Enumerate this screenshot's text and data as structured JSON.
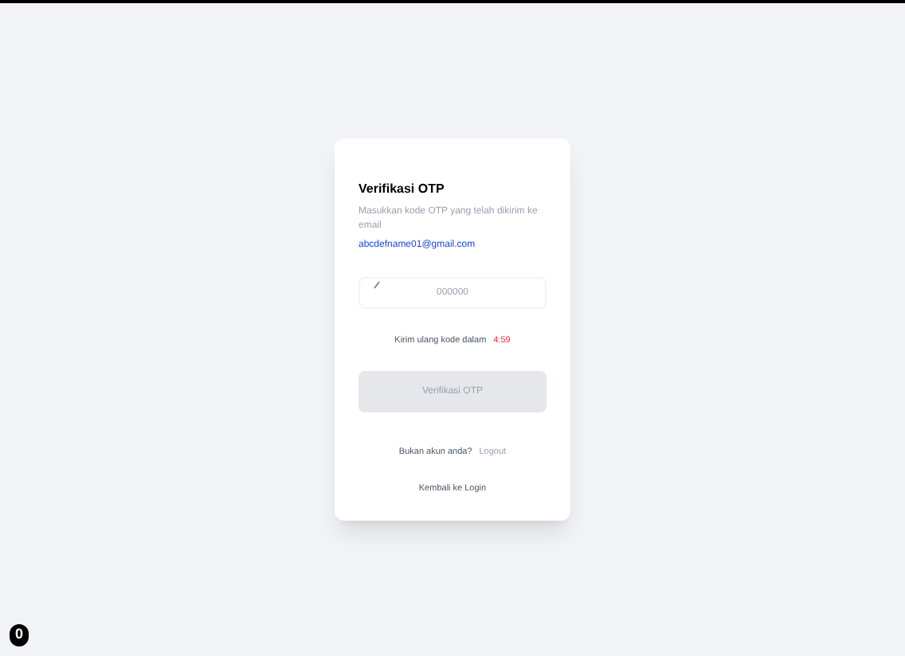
{
  "card": {
    "title": "Verifikasi OTP",
    "description": "Masukkan kode OTP yang telah dikirim ke email",
    "email": "abcdefname01@gmail.com",
    "otp_field": {
      "placeholder": "000000"
    },
    "timer_text": "Kirim ulang kode dalam",
    "timer": "4:59",
    "verify_button": {
      "label": "Verifikasi OTP",
      "disabled": true
    },
    "switch_text": "Bukan akun anda?",
    "switch_link": "Logout",
    "back_link": "Kembali ke Login"
  },
  "badge": "0"
}
